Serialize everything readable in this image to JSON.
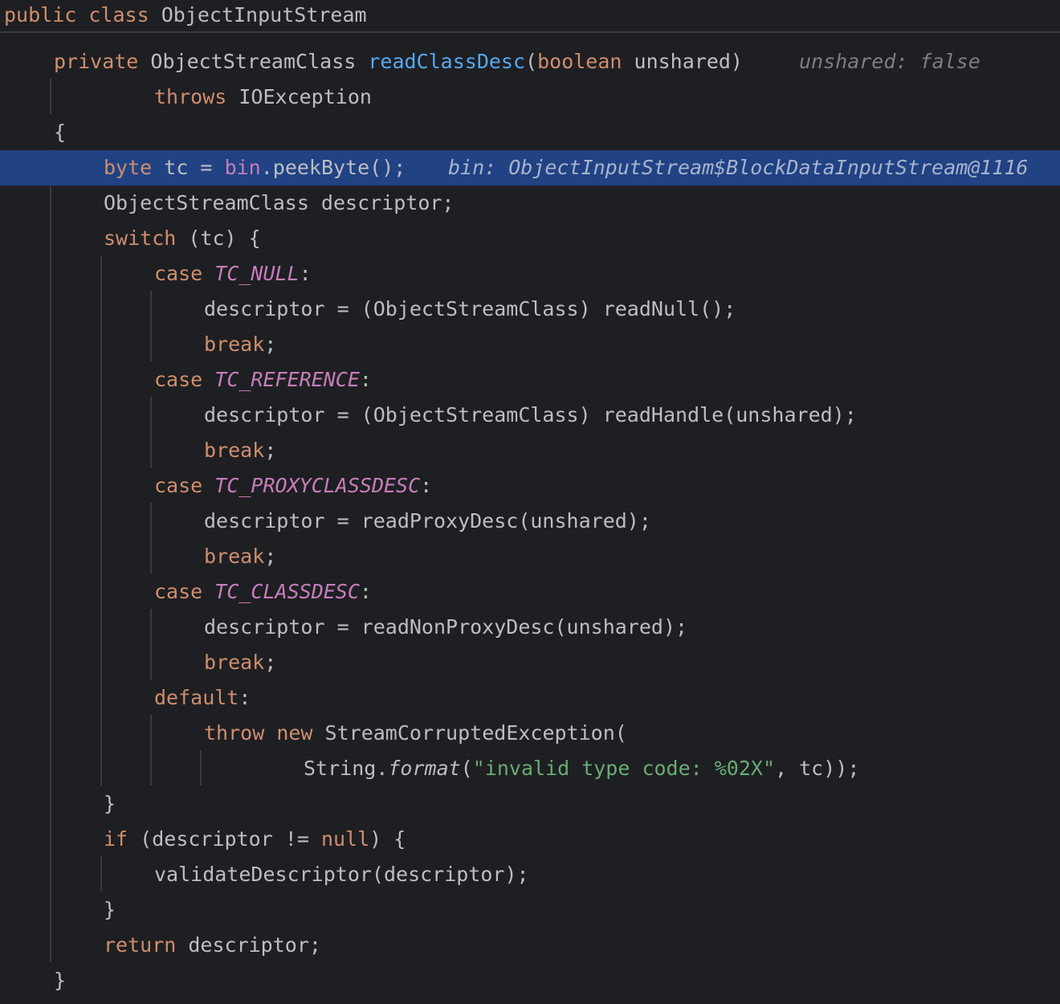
{
  "header": {
    "kw_public": "public",
    "kw_class": "class",
    "class_name": "ObjectInputStream"
  },
  "lines": {
    "l1": {
      "kw": "private",
      "type": "ObjectStreamClass",
      "method": "readClassDesc",
      "paren_open": "(",
      "param_type": "boolean",
      "param": "unshared)",
      "hint": "unshared: false"
    },
    "l2": {
      "kw": "throws",
      "exc": "IOException"
    },
    "l3": {
      "brace": "{"
    },
    "l4": {
      "kw": "byte",
      "var": "tc =",
      "field": "bin",
      "rest": ".peekByte();",
      "hint": "bin: ObjectInputStream$BlockDataInputStream@1116"
    },
    "l5": {
      "text": "ObjectStreamClass descriptor;"
    },
    "l6": {
      "kw": "switch",
      "rest": "(tc) {"
    },
    "l7": {
      "kw": "case",
      "const": "TC_NULL",
      "colon": ":"
    },
    "l8": {
      "text": "descriptor = (ObjectStreamClass) readNull();"
    },
    "l9": {
      "kw": "break",
      "semi": ";"
    },
    "l10": {
      "kw": "case",
      "const": "TC_REFERENCE",
      "colon": ":"
    },
    "l11": {
      "text": "descriptor = (ObjectStreamClass) readHandle(unshared);"
    },
    "l12": {
      "kw": "break",
      "semi": ";"
    },
    "l13": {
      "kw": "case",
      "const": "TC_PROXYCLASSDESC",
      "colon": ":"
    },
    "l14": {
      "text": "descriptor = readProxyDesc(unshared);"
    },
    "l15": {
      "kw": "break",
      "semi": ";"
    },
    "l16": {
      "kw": "case",
      "const": "TC_CLASSDESC",
      "colon": ":"
    },
    "l17": {
      "text": "descriptor = readNonProxyDesc(unshared);"
    },
    "l18": {
      "kw": "break",
      "semi": ";"
    },
    "l19": {
      "kw": "default",
      "colon": ":"
    },
    "l20": {
      "kw1": "throw",
      "kw2": "new",
      "rest": "StreamCorruptedException("
    },
    "l21": {
      "cls": "String.",
      "method": "format",
      "paren": "(",
      "str": "\"invalid type code: %02X\"",
      "rest": ", tc));"
    },
    "l22": {
      "brace": "}"
    },
    "l23": {
      "kw": "if",
      "mid": "(descriptor !=",
      "kw2": "null",
      "rest": ") {"
    },
    "l24": {
      "text": "validateDescriptor(descriptor);"
    },
    "l25": {
      "brace": "}"
    },
    "l26": {
      "kw": "return",
      "rest": "descriptor;"
    },
    "l27": {
      "brace": "}"
    }
  },
  "colors": {
    "background": "#1e1f22",
    "keyword": "#cf8e6d",
    "method_decl": "#56a8f5",
    "constant": "#c77dbb",
    "string": "#6aab73",
    "execution_line": "#214283"
  }
}
